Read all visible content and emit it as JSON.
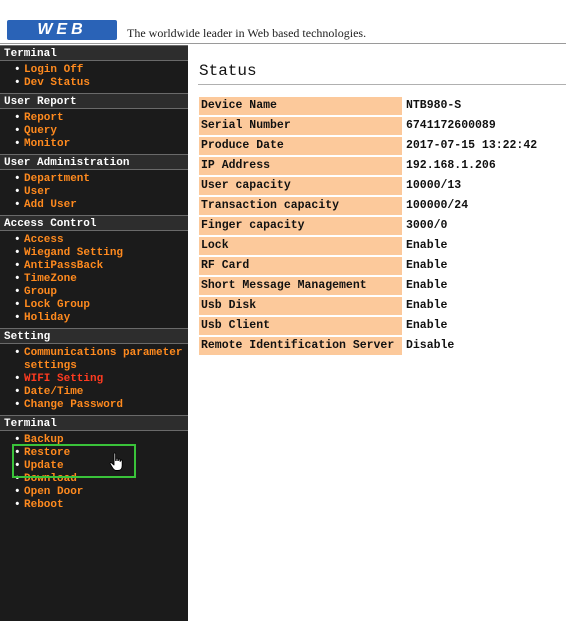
{
  "header": {
    "logo_text": "WEB",
    "tagline": "The worldwide leader in Web based technologies."
  },
  "sidebar": {
    "sections": [
      {
        "title": "Terminal",
        "items": [
          "Login Off",
          "Dev Status"
        ]
      },
      {
        "title": "User Report",
        "items": [
          "Report",
          "Query",
          "Monitor"
        ]
      },
      {
        "title": "User Administration",
        "items": [
          "Department",
          "User",
          "Add User"
        ]
      },
      {
        "title": "Access Control",
        "items": [
          "Access",
          "Wiegand Setting",
          "AntiPassBack",
          "TimeZone",
          "Group",
          "Lock Group",
          "Holiday"
        ]
      },
      {
        "title": "Setting",
        "items": [
          "Communications parameter settings",
          "WIFI Setting",
          "Date/Time",
          "Change Password"
        ]
      },
      {
        "title": "Terminal",
        "items": [
          "Backup",
          "Restore",
          "Update",
          "Download",
          "Open Door",
          "Reboot"
        ]
      }
    ],
    "bullet": "•"
  },
  "main": {
    "title": "Status",
    "rows": [
      {
        "label": "Device Name",
        "value": "NTB980-S"
      },
      {
        "label": "Serial Number",
        "value": "6741172600089"
      },
      {
        "label": "Produce Date",
        "value": "2017-07-15 13:22:42"
      },
      {
        "label": "IP Address",
        "value": "192.168.1.206"
      },
      {
        "label": "User capacity",
        "value": "10000/13"
      },
      {
        "label": "Transaction capacity",
        "value": "100000/24"
      },
      {
        "label": "Finger capacity",
        "value": "3000/0"
      },
      {
        "label": "Lock",
        "value": "Enable"
      },
      {
        "label": "RF Card",
        "value": "Enable"
      },
      {
        "label": "Short Message Management",
        "value": "Enable"
      },
      {
        "label": "Usb Disk",
        "value": "Enable"
      },
      {
        "label": "Usb Client",
        "value": "Enable"
      },
      {
        "label": "Remote Identification Server",
        "value": "Disable"
      }
    ]
  },
  "colors": {
    "sidebar_bg": "#1b1b1b",
    "menu_link": "#ff8a1e",
    "active_link": "#ff3b20",
    "label_bg": "#fcc99b",
    "logo_bg": "#2a63b7",
    "highlight": "#3ac33a"
  },
  "cursor_icon": "hand-pointer-icon"
}
